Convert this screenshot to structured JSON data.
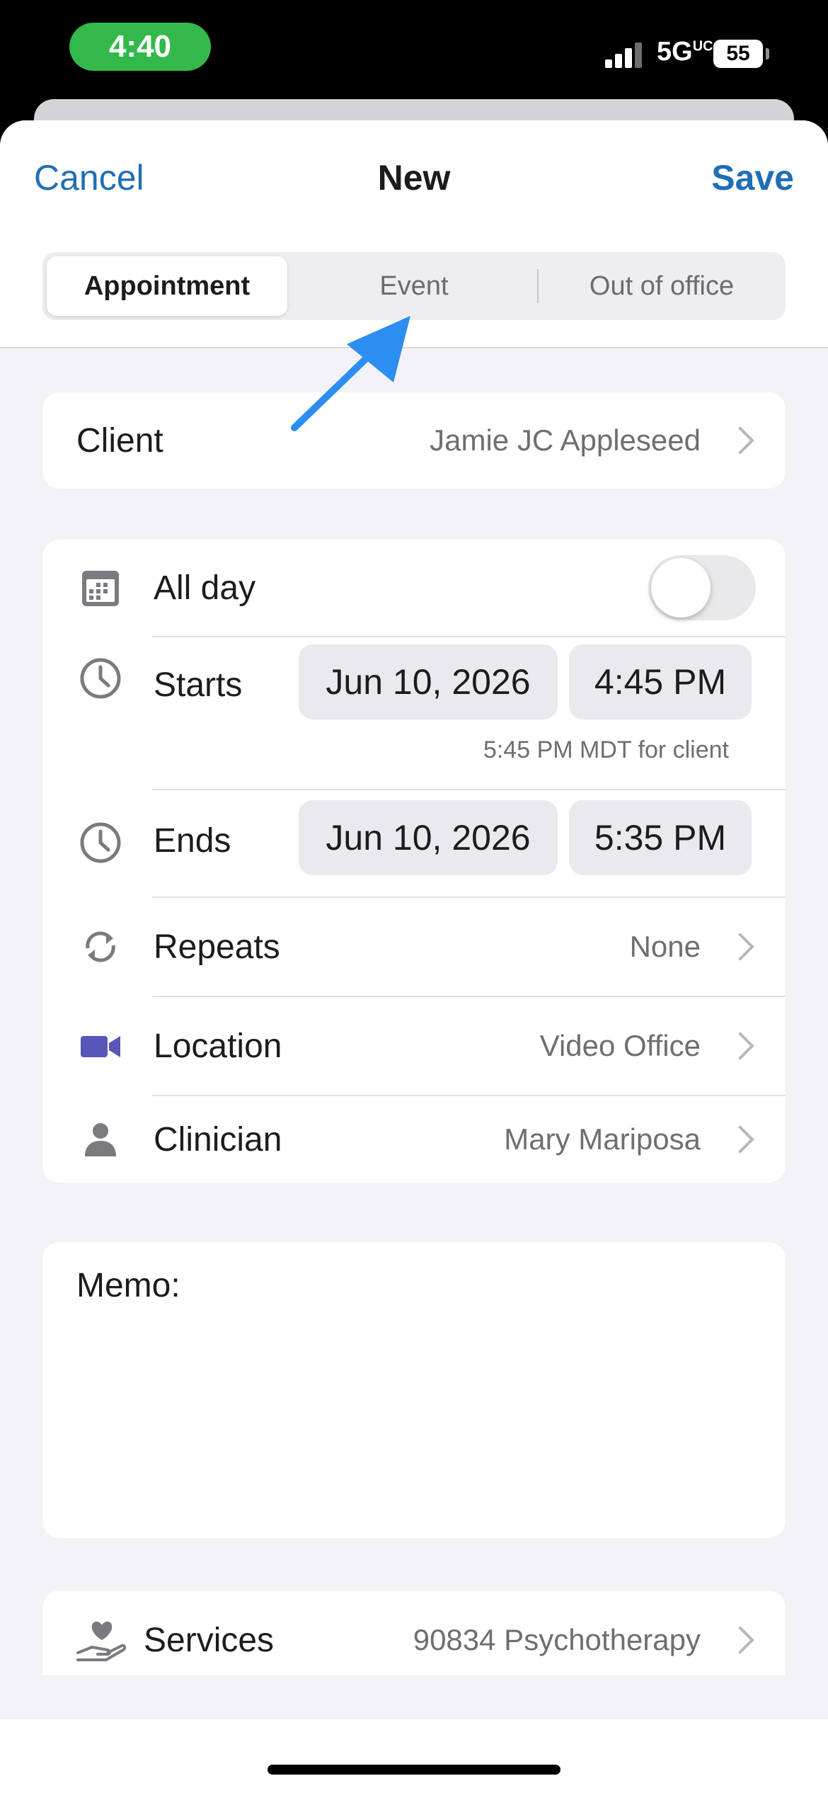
{
  "status_bar": {
    "time": "4:40",
    "network": "5G",
    "network_sup": "UC",
    "battery": "55"
  },
  "header": {
    "cancel_label": "Cancel",
    "title": "New",
    "save_label": "Save"
  },
  "segments": [
    {
      "label": "Appointment",
      "selected": true
    },
    {
      "label": "Event",
      "selected": false
    },
    {
      "label": "Out of office",
      "selected": false
    }
  ],
  "client": {
    "label": "Client",
    "value": "Jamie JC Appleseed"
  },
  "details": {
    "all_day": {
      "label": "All day",
      "on": false,
      "icon": "calendar-icon"
    },
    "starts": {
      "label": "Starts",
      "date": "Jun 10, 2026",
      "time": "4:45 PM",
      "note": "5:45 PM MDT for client",
      "icon": "clock-icon"
    },
    "ends": {
      "label": "Ends",
      "date": "Jun 10, 2026",
      "time": "5:35 PM",
      "icon": "clock-icon"
    },
    "repeats": {
      "label": "Repeats",
      "value": "None",
      "icon": "repeat-icon"
    },
    "location": {
      "label": "Location",
      "value": "Video Office",
      "icon": "video-camera-icon"
    },
    "clinician": {
      "label": "Clinician",
      "value": "Mary Mariposa",
      "icon": "person-icon"
    }
  },
  "memo": {
    "label": "Memo:"
  },
  "services": {
    "label": "Services",
    "value": "90834 Psychotherapy",
    "icon": "heart-hand-icon"
  },
  "colors": {
    "accent": "#1f6fb6",
    "location_icon": "#5856b8",
    "status_time": "#33b94a",
    "annotation_arrow": "#2b8ef0"
  }
}
